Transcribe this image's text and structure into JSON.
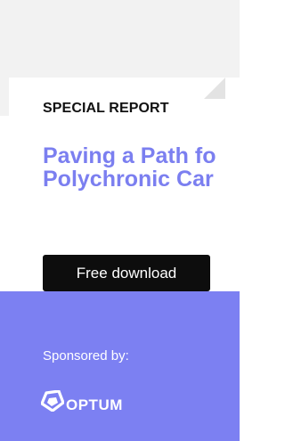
{
  "ad": {
    "eyebrow": "SPECIAL REPORT",
    "headline_line1": "Paving a Path fo",
    "headline_line2": "Polychronic Car",
    "cta_label": "Free download",
    "sponsor_label": "Sponsored by:",
    "sponsor_name": "OPTUM",
    "logo_icon": "optum-logo-icon"
  },
  "colors": {
    "accent": "#7c80f2",
    "headline": "#7b7ff0",
    "button": "#0d0d0d",
    "top_band": "#f2f2f2"
  }
}
